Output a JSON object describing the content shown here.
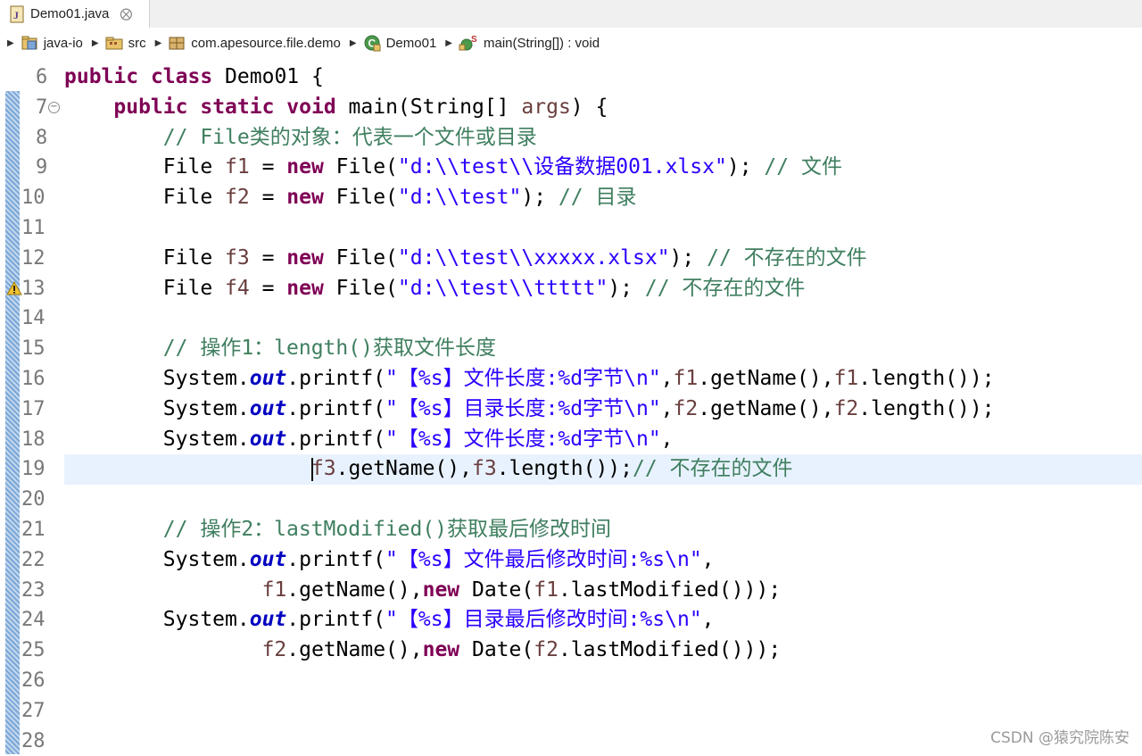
{
  "tab": {
    "label": "Demo01.java",
    "close": "⨂"
  },
  "breadcrumb": [
    {
      "label": "java-io"
    },
    {
      "label": "src"
    },
    {
      "label": "com.apesource.file.demo"
    },
    {
      "label": "Demo01"
    },
    {
      "label": "main(String[]) : void"
    }
  ],
  "lines": [
    {
      "num": "6",
      "tokens": [
        [
          "kw",
          "public"
        ],
        [
          "",
          " "
        ],
        [
          "kw",
          "class"
        ],
        [
          "",
          " Demo01 {"
        ]
      ]
    },
    {
      "num": "7",
      "fold": "−",
      "tokens": [
        [
          "",
          "    "
        ],
        [
          "kw",
          "public"
        ],
        [
          "",
          " "
        ],
        [
          "kw",
          "static"
        ],
        [
          "",
          " "
        ],
        [
          "kw",
          "void"
        ],
        [
          "",
          " main(String[] "
        ],
        [
          "var",
          "args"
        ],
        [
          "",
          ") {"
        ]
      ]
    },
    {
      "num": "8",
      "tokens": [
        [
          "",
          "        "
        ],
        [
          "cm",
          "// File类的对象：代表一个文件或目录"
        ]
      ]
    },
    {
      "num": "9",
      "tokens": [
        [
          "",
          "        File "
        ],
        [
          "var",
          "f1"
        ],
        [
          "",
          " = "
        ],
        [
          "kw",
          "new"
        ],
        [
          "",
          " File("
        ],
        [
          "str",
          "\"d:\\\\test\\\\设备数据001.xlsx\""
        ],
        [
          "",
          "); "
        ],
        [
          "cm",
          "// 文件"
        ]
      ]
    },
    {
      "num": "10",
      "tokens": [
        [
          "",
          "        File "
        ],
        [
          "var",
          "f2"
        ],
        [
          "",
          " = "
        ],
        [
          "kw",
          "new"
        ],
        [
          "",
          " File("
        ],
        [
          "str",
          "\"d:\\\\test\""
        ],
        [
          "",
          "); "
        ],
        [
          "cm",
          "// 目录"
        ]
      ]
    },
    {
      "num": "11",
      "tokens": []
    },
    {
      "num": "12",
      "tokens": [
        [
          "",
          "        File "
        ],
        [
          "var",
          "f3"
        ],
        [
          "",
          " = "
        ],
        [
          "kw",
          "new"
        ],
        [
          "",
          " File("
        ],
        [
          "str",
          "\"d:\\\\test\\\\xxxxx.xlsx\""
        ],
        [
          "",
          "); "
        ],
        [
          "cm",
          "// 不存在的文件"
        ]
      ]
    },
    {
      "num": "13",
      "warn": true,
      "tokens": [
        [
          "",
          "        File "
        ],
        [
          "var",
          "f4"
        ],
        [
          "",
          " = "
        ],
        [
          "kw",
          "new"
        ],
        [
          "",
          " File("
        ],
        [
          "str",
          "\"d:\\\\test\\\\ttttt\""
        ],
        [
          "",
          "); "
        ],
        [
          "cm",
          "// 不存在的文件"
        ]
      ]
    },
    {
      "num": "14",
      "tokens": []
    },
    {
      "num": "15",
      "tokens": [
        [
          "",
          "        "
        ],
        [
          "cm",
          "// 操作1：length()获取文件长度"
        ]
      ]
    },
    {
      "num": "16",
      "tokens": [
        [
          "",
          "        System."
        ],
        [
          "fld",
          "out"
        ],
        [
          "",
          ".printf("
        ],
        [
          "str",
          "\"【%s】文件长度:%d字节\\n\""
        ],
        [
          "",
          ","
        ],
        [
          "var",
          "f1"
        ],
        [
          "",
          ".getName(),"
        ],
        [
          "var",
          "f1"
        ],
        [
          "",
          ".length());"
        ]
      ]
    },
    {
      "num": "17",
      "tokens": [
        [
          "",
          "        System."
        ],
        [
          "fld",
          "out"
        ],
        [
          "",
          ".printf("
        ],
        [
          "str",
          "\"【%s】目录长度:%d字节\\n\""
        ],
        [
          "",
          ","
        ],
        [
          "var",
          "f2"
        ],
        [
          "",
          ".getName(),"
        ],
        [
          "var",
          "f2"
        ],
        [
          "",
          ".length());"
        ]
      ]
    },
    {
      "num": "18",
      "tokens": [
        [
          "",
          "        System."
        ],
        [
          "fld",
          "out"
        ],
        [
          "",
          ".printf("
        ],
        [
          "str",
          "\"【%s】文件长度:%d字节\\n\""
        ],
        [
          "",
          ","
        ]
      ]
    },
    {
      "num": "19",
      "current": true,
      "tokens": [
        [
          "",
          "                    "
        ],
        [
          "caret",
          ""
        ],
        [
          "var",
          "f3"
        ],
        [
          "",
          ".getName(),"
        ],
        [
          "var",
          "f3"
        ],
        [
          "",
          ".length());"
        ],
        [
          "cm",
          "// 不存在的文件"
        ]
      ]
    },
    {
      "num": "20",
      "tokens": []
    },
    {
      "num": "21",
      "tokens": [
        [
          "",
          "        "
        ],
        [
          "cm",
          "// 操作2：lastModified()获取最后修改时间"
        ]
      ]
    },
    {
      "num": "22",
      "tokens": [
        [
          "",
          "        System."
        ],
        [
          "fld",
          "out"
        ],
        [
          "",
          ".printf("
        ],
        [
          "str",
          "\"【%s】文件最后修改时间:%s\\n\""
        ],
        [
          "",
          ","
        ]
      ]
    },
    {
      "num": "23",
      "tokens": [
        [
          "",
          "                "
        ],
        [
          "var",
          "f1"
        ],
        [
          "",
          ".getName(),"
        ],
        [
          "kw",
          "new"
        ],
        [
          "",
          " Date("
        ],
        [
          "var",
          "f1"
        ],
        [
          "",
          ".lastModified()));"
        ]
      ]
    },
    {
      "num": "24",
      "tokens": [
        [
          "",
          "        System."
        ],
        [
          "fld",
          "out"
        ],
        [
          "",
          ".printf("
        ],
        [
          "str",
          "\"【%s】目录最后修改时间:%s\\n\""
        ],
        [
          "",
          ","
        ]
      ]
    },
    {
      "num": "25",
      "tokens": [
        [
          "",
          "                "
        ],
        [
          "var",
          "f2"
        ],
        [
          "",
          ".getName(),"
        ],
        [
          "kw",
          "new"
        ],
        [
          "",
          " Date("
        ],
        [
          "var",
          "f2"
        ],
        [
          "",
          ".lastModified()));"
        ]
      ]
    },
    {
      "num": "26",
      "tokens": []
    },
    {
      "num": "27",
      "tokens": []
    },
    {
      "num": "28",
      "tokens": []
    }
  ],
  "watermark": "CSDN @猿究院陈安",
  "colors": {
    "keyword": "#7f0055",
    "string": "#2a00ff",
    "comment": "#3f7f5f",
    "field": "#0000c0",
    "variable": "#6a3e3e",
    "current_line": "#e8f2fe"
  }
}
